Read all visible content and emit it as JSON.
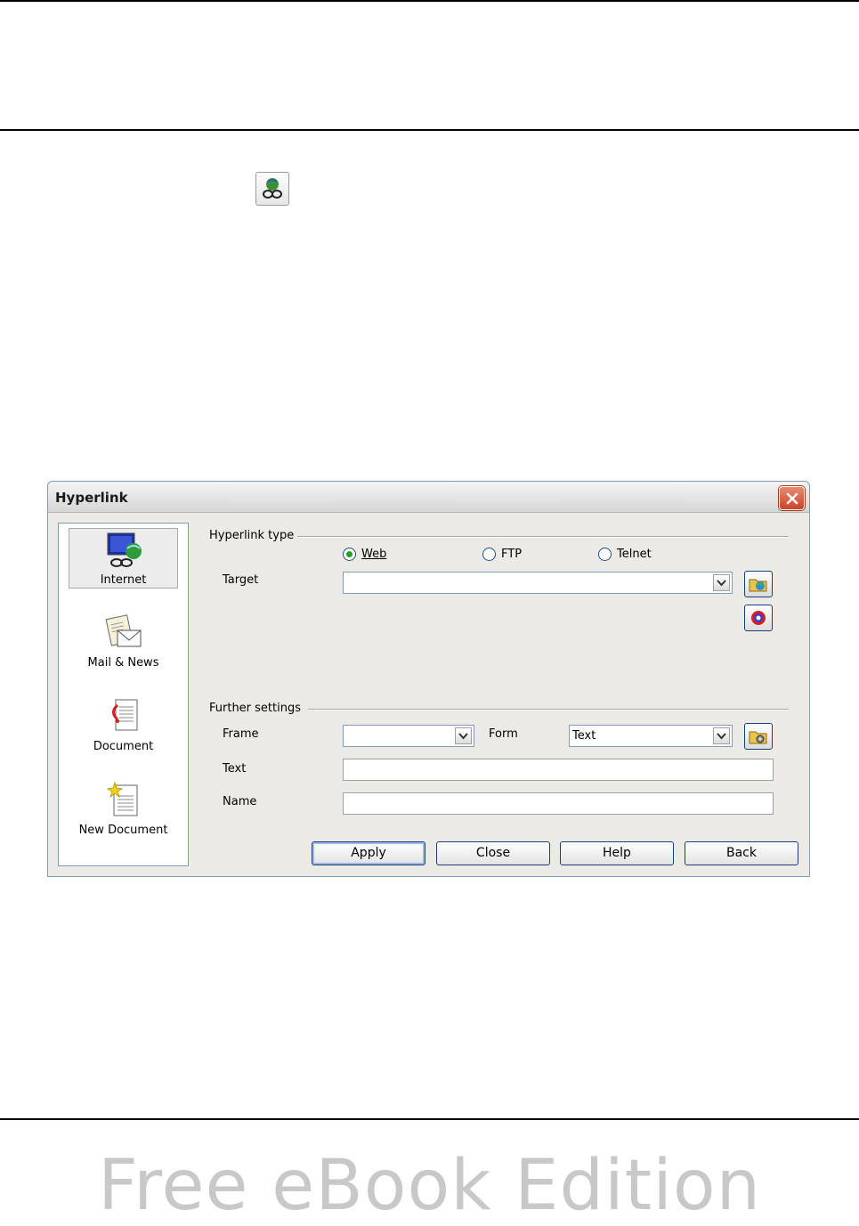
{
  "page": {
    "watermark": "Free eBook Edition"
  },
  "dialog": {
    "title": "Hyperlink",
    "categories": [
      {
        "label": "Internet",
        "icon": "internet-icon",
        "selected": true
      },
      {
        "label": "Mail & News",
        "icon": "mail-news-icon",
        "selected": false
      },
      {
        "label": "Document",
        "icon": "document-icon",
        "selected": false
      },
      {
        "label": "New Document",
        "icon": "new-document-icon",
        "selected": false
      }
    ],
    "hyperlink_type": {
      "heading": "Hyperlink type",
      "options": [
        {
          "label": "Web",
          "selected": true
        },
        {
          "label": "FTP",
          "selected": false
        },
        {
          "label": "Telnet",
          "selected": false
        }
      ]
    },
    "target": {
      "label": "Target",
      "value": ""
    },
    "further_settings": {
      "heading": "Further settings",
      "frame": {
        "label": "Frame",
        "value": ""
      },
      "form": {
        "label": "Form",
        "value": "Text"
      },
      "text": {
        "label": "Text",
        "value": ""
      },
      "name": {
        "label": "Name",
        "value": ""
      }
    },
    "buttons": {
      "apply": "Apply",
      "close": "Close",
      "help": "Help",
      "back": "Back"
    }
  },
  "colors": {
    "accent": "#1c3f7a",
    "close_red": "#c9442a",
    "radio_green": "#21a121"
  }
}
